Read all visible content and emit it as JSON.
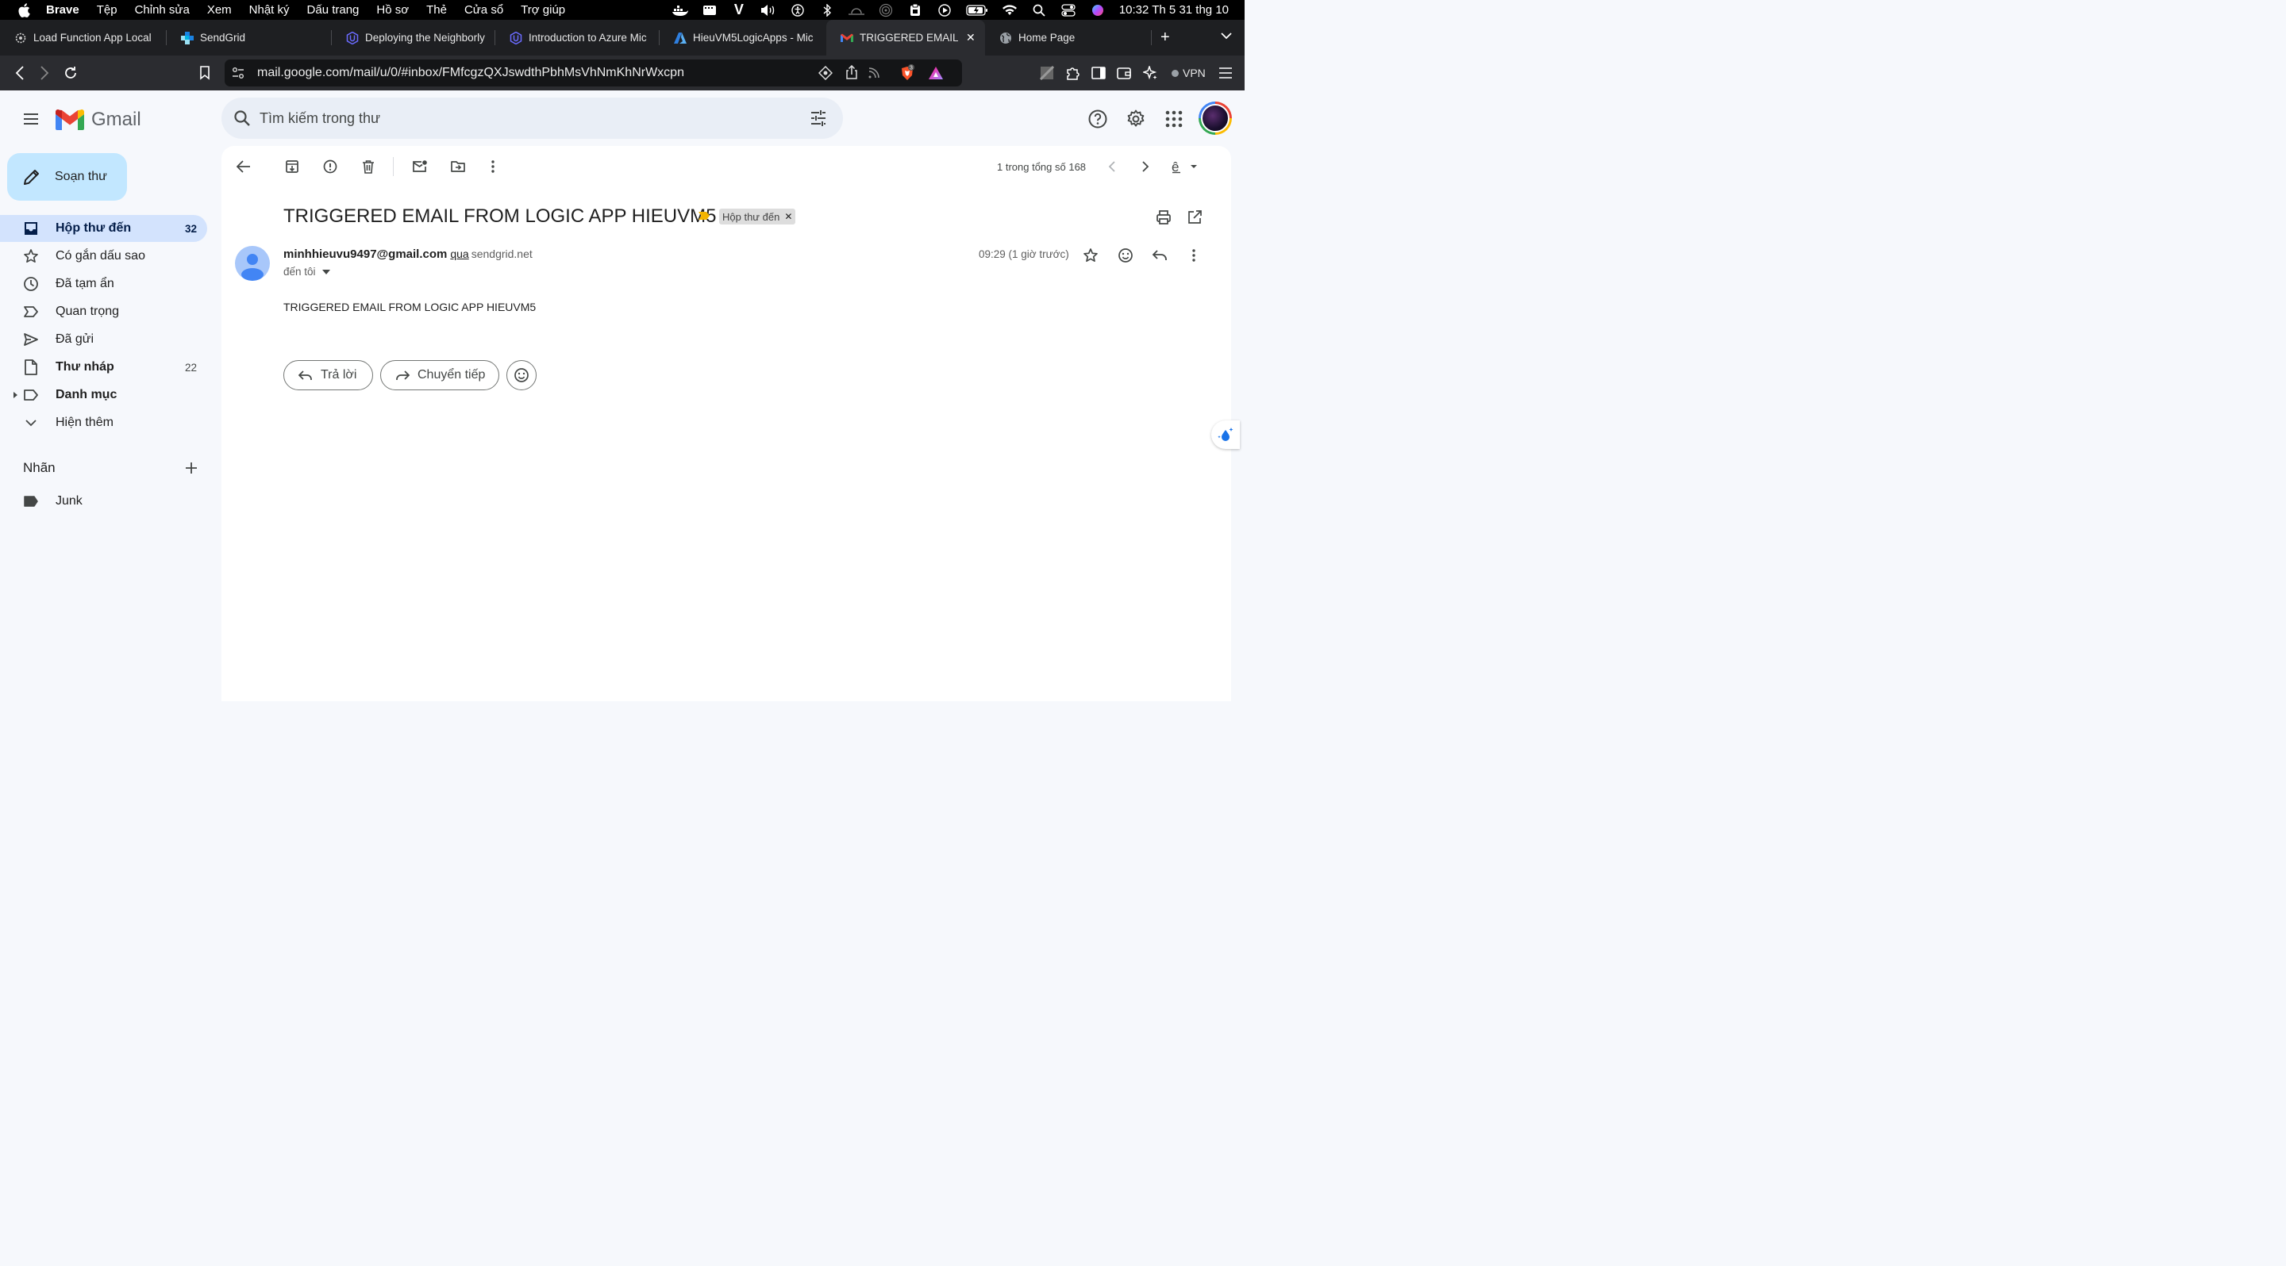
{
  "macos": {
    "menu": [
      "Brave",
      "Tệp",
      "Chỉnh sửa",
      "Xem",
      "Nhật ký",
      "Dấu trang",
      "Hồ sơ",
      "Thẻ",
      "Cửa sổ",
      "Trợ giúp"
    ],
    "clock": "10:32 Th 5 31 thg 10"
  },
  "browser": {
    "tabs": [
      {
        "title": "Load Function App Local",
        "icon": "gear-icon"
      },
      {
        "title": "SendGrid",
        "icon": "sendgrid-icon"
      },
      {
        "title": "Deploying the Neighborly",
        "icon": "udacity-icon"
      },
      {
        "title": "Introduction to Azure Mic",
        "icon": "udacity-icon"
      },
      {
        "title": "HieuVM5LogicApps - Mic",
        "icon": "azure-icon"
      },
      {
        "title": "TRIGGERED EMAIL F",
        "icon": "gmail-icon",
        "active": true
      },
      {
        "title": "Home Page",
        "icon": "globe-icon"
      }
    ],
    "url": "mail.google.com/mail/u/0/#inbox/FMfcgzQXJswdthPbhMsVhNmKhNrWxcpn",
    "shield_count": "3",
    "vpn_label": "VPN"
  },
  "gmail": {
    "logo_text": "Gmail",
    "search_placeholder": "Tìm kiếm trong thư",
    "compose_label": "Soạn thư",
    "nav": [
      {
        "label": "Hộp thư đến",
        "count": "32",
        "icon": "inbox-icon"
      },
      {
        "label": "Có gắn dấu sao",
        "count": "",
        "icon": "star-icon"
      },
      {
        "label": "Đã tạm ẩn",
        "count": "",
        "icon": "clock-icon"
      },
      {
        "label": "Quan trọng",
        "count": "",
        "icon": "important-icon"
      },
      {
        "label": "Đã gửi",
        "count": "",
        "icon": "send-icon"
      },
      {
        "label": "Thư nháp",
        "count": "22",
        "icon": "draft-icon"
      },
      {
        "label": "Danh mục",
        "count": "",
        "icon": "label-icon"
      },
      {
        "label": "Hiện thêm",
        "count": "",
        "icon": "chevron-down-icon"
      }
    ],
    "labels_heading": "Nhãn",
    "labels": [
      {
        "name": "Junk"
      }
    ],
    "pager": "1 trong tổng số 168",
    "email": {
      "subject": "TRIGGERED EMAIL FROM LOGIC APP HIEUVM5",
      "inbox_chip": "Hộp thư đến",
      "sender": "minhhieuvu9497@gmail.com",
      "via_label": "qua",
      "via_domain": "sendgrid.net",
      "to": "đến tôi",
      "time": "09:29 (1 giờ trước)",
      "body": "TRIGGERED EMAIL FROM LOGIC APP HIEUVM5",
      "reply_label": "Trả lời",
      "forward_label": "Chuyển tiếp"
    }
  },
  "colors": {
    "accent": "#0b57d0",
    "compose_bg": "#c2e7ff",
    "active_nav": "#d3e3fd",
    "important": "#f4b400"
  }
}
